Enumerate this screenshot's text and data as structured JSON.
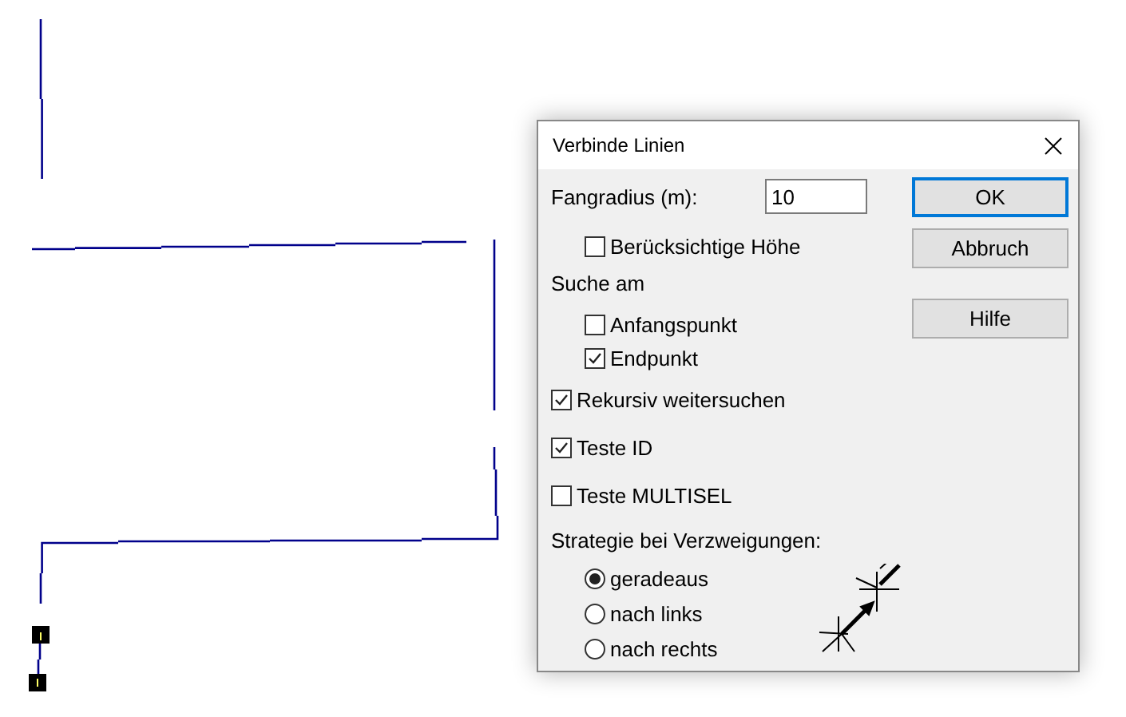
{
  "window": {
    "title": "Verbinde Linien"
  },
  "snap_radius": {
    "label": "Fangradius (m):",
    "value": "10"
  },
  "consider_height": {
    "label": "Berücksichtige Höhe",
    "checked": false
  },
  "search_at": {
    "label": "Suche am",
    "options": [
      {
        "label": "Anfangspunkt",
        "checked": false
      },
      {
        "label": "Endpunkt",
        "checked": true
      }
    ]
  },
  "checks": [
    {
      "label": "Rekursiv weitersuchen",
      "checked": true
    },
    {
      "label": "Teste ID",
      "checked": true
    },
    {
      "label": "Teste MULTISEL",
      "checked": false
    }
  ],
  "strategy": {
    "label": "Strategie bei Verzweigungen:",
    "options": [
      {
        "label": "geradeaus",
        "selected": true
      },
      {
        "label": "nach links",
        "selected": false
      },
      {
        "label": "nach rechts",
        "selected": false
      }
    ]
  },
  "buttons": [
    {
      "label": "OK",
      "focused": true
    },
    {
      "label": "Abbruch",
      "focused": false
    },
    {
      "label": "Hilfe",
      "focused": false
    }
  ]
}
